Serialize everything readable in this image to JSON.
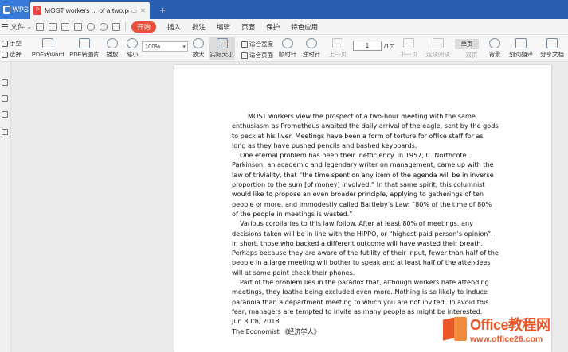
{
  "titlebar": {
    "app_tab": "WPS",
    "doc_tab_title": "MOST workers ... of a two.pdf",
    "new_tab": "+"
  },
  "menubar": {
    "file": "文件",
    "start": "开始",
    "items": [
      "插入",
      "批注",
      "编辑",
      "页面",
      "保护",
      "特色应用"
    ]
  },
  "ribbon": {
    "hand": "手型",
    "select": "选择",
    "pdf_to_word": "PDF转Word",
    "pdf_to_image": "PDF转图片",
    "play": "播放",
    "zoom_out": "缩小",
    "zoom_value": "100%",
    "zoom_in": "放大",
    "actual_size": "实际大小",
    "fit_width": "适合宽度",
    "fit_page": "适合页面",
    "rotate_cw": "顺时针",
    "rotate_ccw": "逆时针",
    "prev_page": "上一页",
    "page_current": "1",
    "page_total": "/1页",
    "next_page": "下一页",
    "continuous": "连续阅读",
    "single_page": "单页",
    "double_page": "双页",
    "background": "背景",
    "translate": "划词翻译",
    "share": "分享文档"
  },
  "document": {
    "p1": "MOST workers view the prospect of a two-hour meeting with the same enthusiasm as Prometheus awaited the daily arrival of the eagle, sent by the gods to peck at his liver. Meetings have been a form of torture for office staff for as long as they have pushed pencils and bashed keyboards.",
    "p2": "One eternal problem has been their inefficiency. In 1957, C. Northcote Parkinson, an academic    and legendary writer on management, came up with the law of triviality, that “the time spent on any item of the agenda will be in inverse proportion to the sum [of money] involved.” In that same spirit, this columnist would like to propose an even broader principle, applying to gatherings of ten people or more, and immodestly called Bartleby’s Law: “80% of the time of 80% of the people in meetings is wasted.”",
    "p3": "Various corollaries to this law follow. After at least 80% of meetings, any decisions taken will be in line with the HIPPO, or “highest-paid person’s opinion”. In short, those who backed a different outcome will have wasted their breath. Perhaps because they are aware of the futility of their input, fewer than half of the people in a large meeting will bother to speak and at least half of the attendees will at some point check their phones.",
    "p4": "Part of the problem lies in the paradox that, although workers hate attending meetings, they loathe being excluded even more. Nothing is so likely to induce paranoia than a department meeting to which you are not invited. To avoid this fear, managers are tempted to invite as many people as might be interested.",
    "date": "Jun 30th, 2018",
    "source": "The Economist    《经济学人》"
  },
  "watermark": {
    "line1": "Office教程网",
    "line2": "www.office26.com"
  },
  "colors": {
    "titlebar": "#2a5fb0",
    "start_button": "#e84f3c",
    "watermark": "#e8562a"
  }
}
